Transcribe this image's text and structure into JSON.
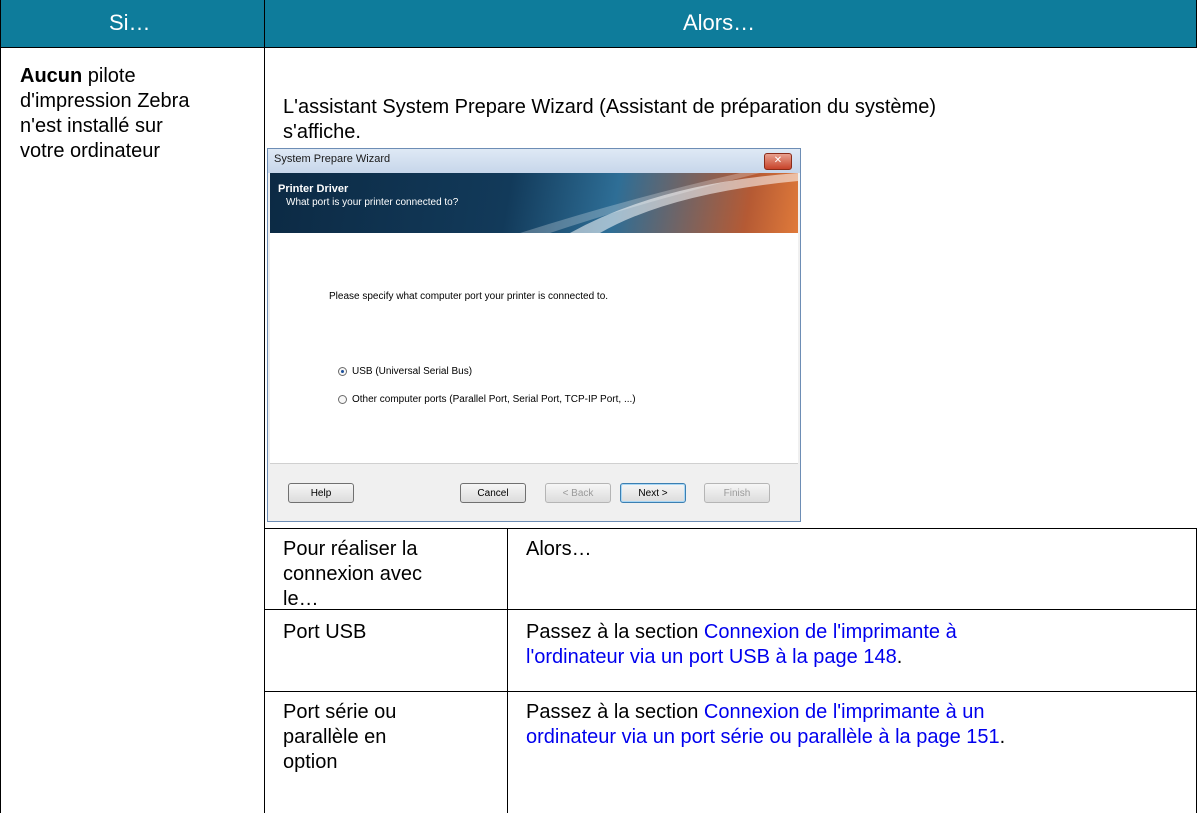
{
  "header": {
    "col1": "Si…",
    "col2": "Alors…"
  },
  "row1": {
    "condition_bold": "Aucun",
    "condition_rest_1": " pilote",
    "condition_line2": "d'impression Zebra",
    "condition_line3": "n'est installé sur",
    "condition_line4": "votre ordinateur",
    "result_line1": "L'assistant System Prepare Wizard (Assistant de préparation du système)",
    "result_line2": "s'affiche."
  },
  "wizard": {
    "title": "System Prepare Wizard",
    "banner_title": "Printer Driver",
    "banner_subtitle": "What port is your printer connected to?",
    "prompt": "Please specify what computer port your printer is connected to.",
    "options": [
      {
        "label": "USB (Universal Serial Bus)",
        "selected": true
      },
      {
        "label": "Other computer ports (Parallel Port, Serial Port, TCP-IP Port, ...)",
        "selected": false
      }
    ],
    "buttons": {
      "help": "Help",
      "cancel": "Cancel",
      "back": "< Back",
      "next": "Next >",
      "finish": "Finish"
    }
  },
  "subtable": {
    "header": {
      "col1_line1": "Pour réaliser la",
      "col1_line2": "connexion avec",
      "col1_line3": "le…",
      "col2": "Alors…"
    },
    "rows": [
      {
        "col1_line1": "Port USB",
        "col2_prefix": "Passez à la section ",
        "col2_link_line1": "Connexion de l'imprimante à",
        "col2_link_line2": "l'ordinateur via un port USB à la page 148",
        "col2_suffix": "."
      },
      {
        "col1_line1": "Port série ou",
        "col1_line2": "parallèle en",
        "col1_line3": "option",
        "col2_prefix": "Passez à la section ",
        "col2_link_line1": "Connexion de l'imprimante à un",
        "col2_link_line2": "ordinateur via un port série ou parallèle à la page 151",
        "col2_suffix": "."
      }
    ]
  },
  "colors": {
    "header_bg": "#0e7c9b",
    "link": "#0000ee"
  }
}
